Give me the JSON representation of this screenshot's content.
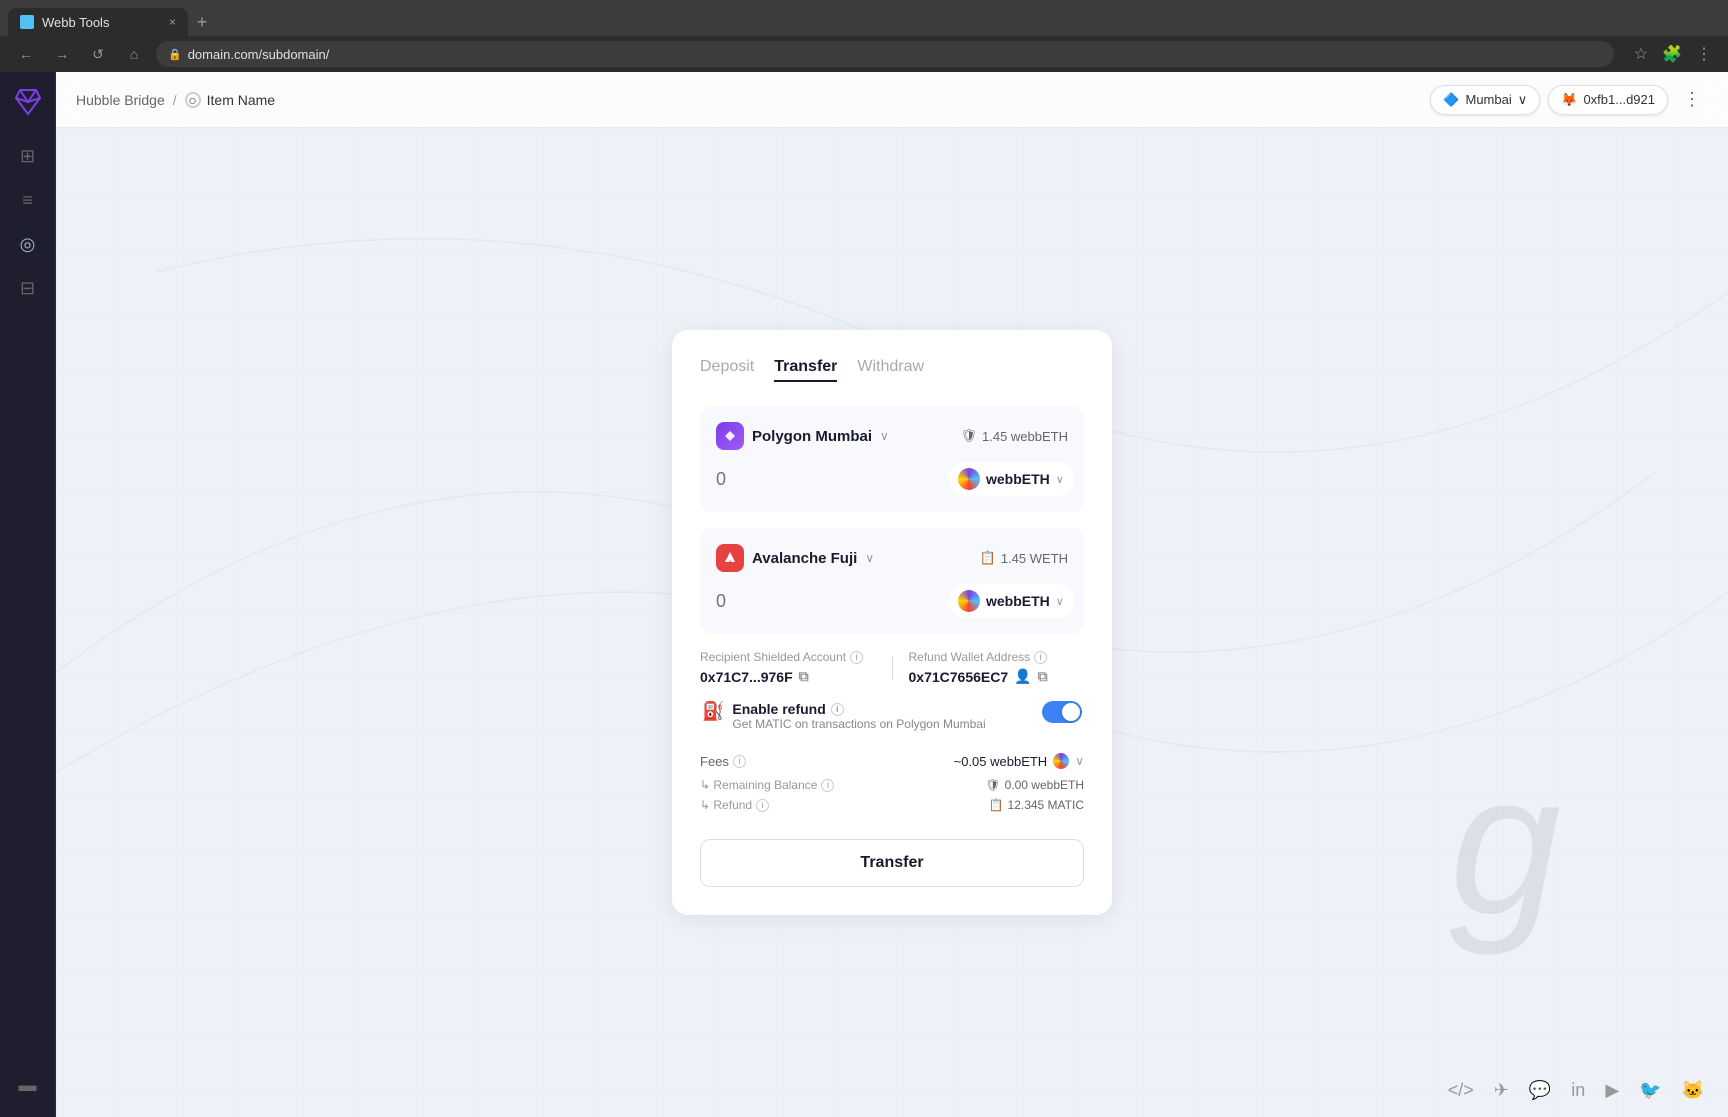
{
  "browser": {
    "tab_title": "Webb Tools",
    "tab_icon": "🔷",
    "tab_close": "×",
    "tab_add": "+",
    "address": "domain.com/subdomain/",
    "nav_back": "←",
    "nav_forward": "→",
    "nav_refresh": "↺",
    "nav_home": "⌂"
  },
  "sidebar": {
    "logo": "✕",
    "items": [
      {
        "id": "grid",
        "icon": "⊞",
        "active": false
      },
      {
        "id": "list",
        "icon": "≡",
        "active": false
      },
      {
        "id": "circle",
        "icon": "◎",
        "active": true
      },
      {
        "id": "layout",
        "icon": "⊟",
        "active": false
      }
    ],
    "bottom_item": {
      "id": "console",
      "icon": "▬"
    }
  },
  "header": {
    "breadcrumb_root": "Hubble Bridge",
    "breadcrumb_sep": "/",
    "breadcrumb_current": "Item Name",
    "network_label": "Mumbai",
    "network_icon": "🦊",
    "wallet_label": "0xfb1...d921",
    "wallet_icon": "🦊",
    "more_icon": "⋮"
  },
  "card": {
    "tabs": [
      {
        "id": "deposit",
        "label": "Deposit",
        "active": false
      },
      {
        "id": "transfer",
        "label": "Transfer",
        "active": true
      },
      {
        "id": "withdraw",
        "label": "Withdraw",
        "active": false
      }
    ],
    "source_chain": {
      "name": "Polygon Mumbai",
      "balance": "1.45 webbETH",
      "balance_icon": "🛡",
      "amount_placeholder": "0",
      "token": "webbETH",
      "token_chevron": "∨"
    },
    "dest_chain": {
      "name": "Avalanche Fuji",
      "balance": "1.45 WETH",
      "balance_icon": "📋",
      "amount_placeholder": "0",
      "token": "webbETH",
      "token_chevron": "∨"
    },
    "recipient_label": "Recipient Shielded Account",
    "recipient_value": "0x71C7...976F",
    "refund_wallet_label": "Refund Wallet Address",
    "refund_wallet_value": "0x71C7656EC7",
    "enable_refund_label": "Enable refund",
    "enable_refund_desc": "Get MATIC on transactions on Polygon Mumbai",
    "enable_refund_info": "ℹ",
    "fees_label": "Fees",
    "fees_value": "~0.05 webbETH",
    "remaining_balance_label": "↳ Remaining Balance",
    "remaining_balance_value": "0.00 webbETH",
    "remaining_balance_icon": "🛡",
    "refund_label": "↳ Refund",
    "refund_value": "12.345 MATIC",
    "refund_icon": "📋",
    "transfer_btn": "Transfer"
  },
  "footer": {
    "icons": [
      "</> ",
      "✈",
      "💬",
      "in",
      "▶",
      "🐦",
      "🐱"
    ]
  }
}
